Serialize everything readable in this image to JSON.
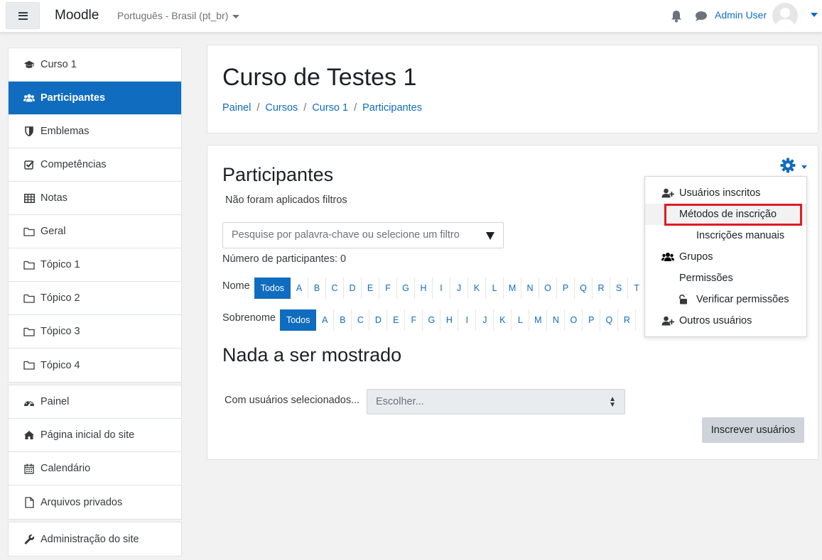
{
  "navbar": {
    "brand": "Moodle",
    "language": "Português - Brasil ‎(pt_br)‎",
    "user_name": "Admin User"
  },
  "sidebar": {
    "course_items": [
      {
        "label": "Curso 1",
        "icon": "graduation-cap-icon"
      },
      {
        "label": "Participantes",
        "icon": "users-icon",
        "active": true
      },
      {
        "label": "Emblemas",
        "icon": "shield-icon"
      },
      {
        "label": "Competências",
        "icon": "checkbox-icon"
      },
      {
        "label": "Notas",
        "icon": "table-icon"
      },
      {
        "label": "Geral",
        "icon": "folder-icon"
      },
      {
        "label": "Tópico 1",
        "icon": "folder-icon"
      },
      {
        "label": "Tópico 2",
        "icon": "folder-icon"
      },
      {
        "label": "Tópico 3",
        "icon": "folder-icon"
      },
      {
        "label": "Tópico 4",
        "icon": "folder-icon"
      }
    ],
    "site_items": [
      {
        "label": "Painel",
        "icon": "dashboard-icon"
      },
      {
        "label": "Página inicial do site",
        "icon": "home-icon"
      },
      {
        "label": "Calendário",
        "icon": "calendar-icon"
      },
      {
        "label": "Arquivos privados",
        "icon": "file-icon"
      }
    ],
    "admin_items": [
      {
        "label": "Administração do site",
        "icon": "wrench-icon"
      }
    ]
  },
  "header": {
    "course_title": "Curso de Testes 1",
    "breadcrumb": [
      "Painel",
      "Cursos",
      "Curso 1",
      "Participantes"
    ]
  },
  "main": {
    "title": "Participantes",
    "filters_status": "Não foram aplicados filtros",
    "search_placeholder": "Pesquise por palavra-chave ou selecione um filtro",
    "participant_count": "Número de participantes: 0",
    "first_name_label": "Nome",
    "last_name_label": "Sobrenome",
    "all_label": "Todos",
    "first_name_letters": [
      "A",
      "B",
      "C",
      "D",
      "E",
      "F",
      "G",
      "H",
      "I",
      "J",
      "K",
      "L",
      "M",
      "N",
      "O",
      "P",
      "Q",
      "R",
      "S",
      "T"
    ],
    "last_name_letters": [
      "A",
      "B",
      "C",
      "D",
      "E",
      "F",
      "G",
      "H",
      "I",
      "J",
      "K",
      "L",
      "M",
      "N",
      "O",
      "P",
      "Q",
      "R"
    ],
    "empty_message": "Nada a ser mostrado",
    "with_selected_label": "Com usuários selecionados...",
    "choose_placeholder": "Escolher...",
    "enrol_button": "Inscrever usuários"
  },
  "dropdown": {
    "items": [
      {
        "label": "Usuários inscritos",
        "icon": "user-plus-icon"
      },
      {
        "label": "Métodos de inscrição",
        "icon": ""
      },
      {
        "label": "Inscrições manuais",
        "icon": ""
      },
      {
        "label": "Grupos",
        "icon": "users-icon"
      },
      {
        "label": "Permissões",
        "icon": ""
      },
      {
        "label": "Verificar permissões",
        "icon": "unlock-icon"
      },
      {
        "label": "Outros usuários",
        "icon": "user-plus-icon"
      }
    ]
  },
  "colors": {
    "accent": "#0f6cbf",
    "highlight": "#e01b24"
  }
}
